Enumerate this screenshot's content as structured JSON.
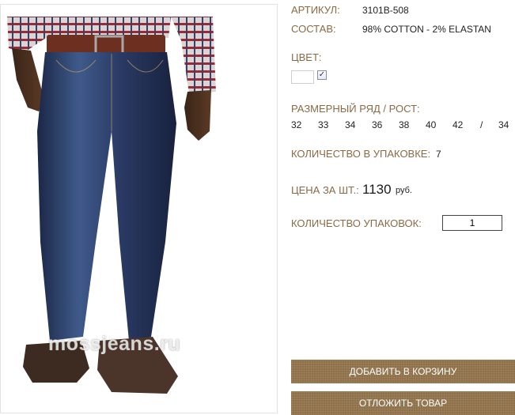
{
  "product": {
    "article_label": "АРТИКУЛ:",
    "article_value": "3101B-508",
    "composition_label": "СОСТАВ:",
    "composition_value": "98% COTTON - 2% ELASTAN",
    "color_label": "ЦВЕТ:",
    "color_checkbox": "✓",
    "size_label": "РАЗМЕРНЫЙ РЯД / РОСТ:",
    "sizes": [
      "32",
      "33",
      "34",
      "36",
      "38",
      "40",
      "42",
      "/",
      "34"
    ],
    "pack_qty_label": "КОЛИЧЕСТВО В УПАКОВКЕ:",
    "pack_qty_value": "7",
    "price_label": "ЦЕНА ЗА ШТ.:",
    "price_value": "1130",
    "currency": "руб.",
    "packs_label": "КОЛИЧЕСТВО УПАКОВОК:",
    "packs_value": "1"
  },
  "image": {
    "watermark": "mossjeans.ru"
  },
  "buttons": {
    "add_to_cart": "ДОБАВИТЬ В КОРЗИНУ",
    "defer": "ОТЛОЖИТЬ ТОВАР"
  },
  "colors": {
    "label": "#8a6a44",
    "button": "#8f7049"
  }
}
